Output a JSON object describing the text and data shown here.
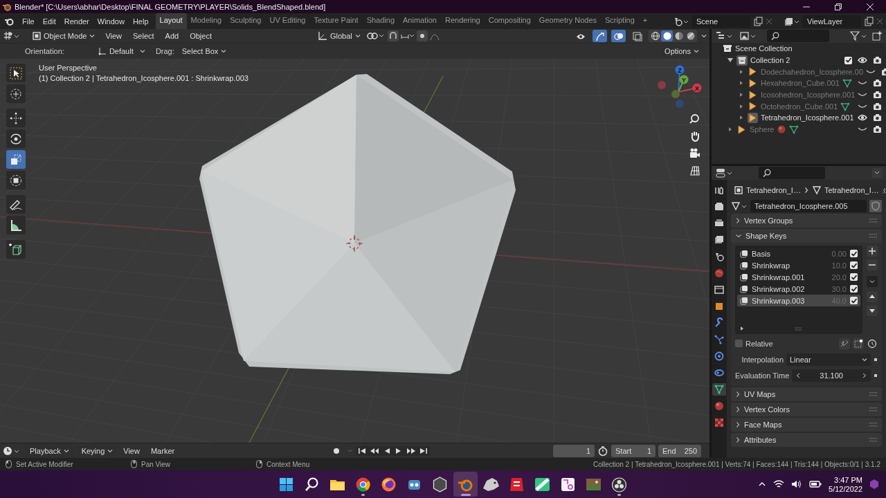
{
  "window": {
    "title": "Blender* [C:\\Users\\abhar\\Desktop\\FINAL GEOMETRY\\PLAYER\\Solids_BlendShaped.blend]"
  },
  "menu": [
    "File",
    "Edit",
    "Render",
    "Window",
    "Help"
  ],
  "workspaces": [
    {
      "label": "Layout",
      "selected": true
    },
    {
      "label": "Modeling",
      "selected": false
    },
    {
      "label": "Sculpting",
      "selected": false
    },
    {
      "label": "UV Editing",
      "selected": false
    },
    {
      "label": "Texture Paint",
      "selected": false
    },
    {
      "label": "Shading",
      "selected": false
    },
    {
      "label": "Animation",
      "selected": false
    },
    {
      "label": "Rendering",
      "selected": false
    },
    {
      "label": "Compositing",
      "selected": false
    },
    {
      "label": "Geometry Nodes",
      "selected": false
    },
    {
      "label": "Scripting",
      "selected": false
    }
  ],
  "add_workspace": "+",
  "scene": "Scene",
  "view_layer": "ViewLayer",
  "viewport_header": {
    "mode": "Object Mode",
    "menus": [
      "View",
      "Select",
      "Add",
      "Object"
    ],
    "orientation": "Global",
    "toggles": [
      {
        "kind": "visibility",
        "on": false
      },
      {
        "kind": "gizmo",
        "on": true
      },
      {
        "kind": "overlay",
        "on": true
      },
      {
        "kind": "xray",
        "on": false
      }
    ],
    "shading": [
      {
        "kind": "wireframe",
        "selected": false
      },
      {
        "kind": "solid",
        "selected": true
      },
      {
        "kind": "material",
        "selected": false
      },
      {
        "kind": "rendered",
        "selected": false
      }
    ]
  },
  "tool_settings": {
    "orientation_label": "Orientation:",
    "orientation": "Default",
    "drag_label": "Drag:",
    "drag": "Select Box",
    "options": "Options"
  },
  "tools": [
    {
      "kind": "select",
      "selected": false
    },
    {
      "kind": "cursor",
      "selected": false
    },
    {
      "kind": "move",
      "selected": false
    },
    {
      "kind": "rotate",
      "selected": false
    },
    {
      "kind": "scale",
      "selected": true
    },
    {
      "kind": "transform",
      "selected": false
    },
    {
      "kind": "annotate",
      "selected": false
    },
    {
      "kind": "measure",
      "selected": false
    },
    {
      "kind": "add-cube",
      "selected": false
    }
  ],
  "viewport": {
    "title": "User Perspective",
    "info": "(1) Collection 2 | Tetrahedron_Icosphere.001 : Shrinkwrap.003",
    "axes": [
      "Z",
      "Y",
      "X"
    ]
  },
  "outliner": {
    "root": "Scene Collection",
    "items": [
      {
        "name": "Collection 2",
        "kind": "collection",
        "expanded": true,
        "checked": true,
        "visible": true,
        "selected": true,
        "children": [
          {
            "name": "Dodechahedron_Icosphere.00",
            "kind": "mesh",
            "visible": false,
            "selected": false
          },
          {
            "name": "Hexahedron_Cube.001",
            "kind": "mesh",
            "visible": false,
            "selected": false,
            "has_mesh_data": true
          },
          {
            "name": "Icosohedron_Icosphere.001",
            "kind": "mesh",
            "visible": false,
            "selected": false
          },
          {
            "name": "Octohedron_Cube.001",
            "kind": "mesh",
            "visible": false,
            "selected": false,
            "has_mesh_data": true
          },
          {
            "name": "Tetrahedron_Icosphere.001",
            "kind": "mesh",
            "visible": true,
            "selected": true
          }
        ]
      },
      {
        "name": "Sphere",
        "kind": "mesh",
        "visible": false,
        "selected": false,
        "has_material": true,
        "has_mesh_data": true
      }
    ]
  },
  "properties": {
    "tabs": [
      {
        "kind": "tool",
        "selected": false
      },
      {
        "kind": "render",
        "selected": false
      },
      {
        "kind": "output",
        "selected": false
      },
      {
        "kind": "view-layer",
        "selected": false
      },
      {
        "kind": "scene",
        "selected": false
      },
      {
        "kind": "world",
        "selected": false
      },
      {
        "kind": "collection",
        "selected": false
      },
      {
        "kind": "object",
        "selected": false
      },
      {
        "kind": "modifiers",
        "selected": false
      },
      {
        "kind": "particles",
        "selected": false
      },
      {
        "kind": "physics",
        "selected": false
      },
      {
        "kind": "constraints",
        "selected": false
      },
      {
        "kind": "data",
        "selected": true
      },
      {
        "kind": "material",
        "selected": false
      },
      {
        "kind": "texture",
        "selected": false
      }
    ],
    "breadcrumb": [
      "Tetrahedron_I…",
      "Tetrahedron_I…"
    ],
    "mesh_name": "Tetrahedron_Icosphere.005",
    "panels_before": [
      {
        "label": "Vertex Groups",
        "expanded": false
      }
    ],
    "shape_keys": {
      "label": "Shape Keys",
      "expanded": true,
      "keys": [
        {
          "name": "Basis",
          "value": "0.00",
          "checked": true,
          "selected": false
        },
        {
          "name": "Shrinkwrap",
          "value": "10.0",
          "checked": true,
          "selected": false
        },
        {
          "name": "Shrinkwrap.001",
          "value": "20.0",
          "checked": true,
          "selected": false
        },
        {
          "name": "Shrinkwrap.002",
          "value": "30.0",
          "checked": true,
          "selected": false
        },
        {
          "name": "Shrinkwrap.003",
          "value": "40.0",
          "checked": true,
          "selected": true
        }
      ],
      "relative": {
        "label": "Relative",
        "checked": false
      },
      "interpolation": {
        "label": "Interpolation",
        "value": "Linear"
      },
      "evaluation_time": {
        "label": "Evaluation Time",
        "value": "31.100"
      }
    },
    "panels_after": [
      {
        "label": "UV Maps",
        "expanded": false
      },
      {
        "label": "Vertex Colors",
        "expanded": false
      },
      {
        "label": "Face Maps",
        "expanded": false
      },
      {
        "label": "Attributes",
        "expanded": false
      }
    ]
  },
  "timeline": {
    "menus": [
      "Playback",
      "Keying"
    ],
    "plain_menus": [
      "View",
      "Marker"
    ],
    "current_frame": "1",
    "start_label": "Start",
    "start": "1",
    "end_label": "End",
    "end": "250"
  },
  "status_bar": {
    "hints": [
      "Set Active Modifier",
      "Pan View",
      "Context Menu"
    ],
    "stats": "Collection 2 | Tetrahedron_Icosphere.001 | Verts:74 | Faces:144 | Tris:144 | Objects:0/1 | 3.1.2"
  },
  "taskbar": {
    "apps": [
      {
        "kind": "start",
        "running": false,
        "selected": false
      },
      {
        "kind": "search",
        "running": false,
        "selected": false
      },
      {
        "kind": "folder",
        "running": false,
        "selected": false
      },
      {
        "kind": "browser",
        "running": true,
        "selected": false
      },
      {
        "kind": "fox",
        "running": false,
        "selected": false
      },
      {
        "kind": "robot",
        "running": false,
        "selected": false
      },
      {
        "kind": "hexagon",
        "running": false,
        "selected": false
      },
      {
        "kind": "orbit",
        "running": true,
        "selected": true
      },
      {
        "kind": "creature",
        "running": false,
        "selected": false
      },
      {
        "kind": "document",
        "running": false,
        "selected": false
      },
      {
        "kind": "board",
        "running": false,
        "selected": false
      },
      {
        "kind": "snip",
        "running": false,
        "selected": false
      },
      {
        "kind": "photo",
        "running": false,
        "selected": false
      },
      {
        "kind": "record",
        "running": true,
        "selected": false
      }
    ],
    "time": "3:47 PM",
    "date": "5/12/2022"
  }
}
